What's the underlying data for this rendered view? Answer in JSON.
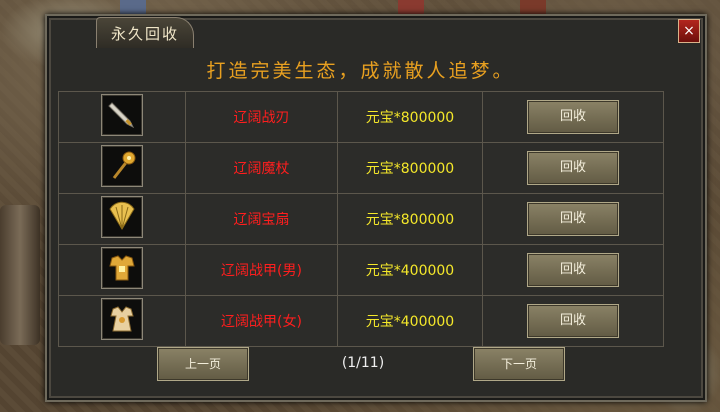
{
  "window": {
    "title": "永久回收",
    "close_label": "×"
  },
  "slogan": "打造完美生态，成就散人追梦。",
  "items": [
    {
      "icon": "blade-icon",
      "name": "辽阔战刃",
      "price": "元宝*800000",
      "action": "回收"
    },
    {
      "icon": "staff-icon",
      "name": "辽阔魔杖",
      "price": "元宝*800000",
      "action": "回收"
    },
    {
      "icon": "fan-icon",
      "name": "辽阔宝扇",
      "price": "元宝*800000",
      "action": "回收"
    },
    {
      "icon": "armor-male-icon",
      "name": "辽阔战甲(男)",
      "price": "元宝*400000",
      "action": "回收"
    },
    {
      "icon": "armor-female-icon",
      "name": "辽阔战甲(女)",
      "price": "元宝*400000",
      "action": "回收"
    }
  ],
  "pager": {
    "prev_label": "上一页",
    "page_indicator": "(1/11)",
    "next_label": "下一页"
  },
  "colors": {
    "item_name": "#ff1e1e",
    "price": "#f5e82a",
    "slogan": "#e8a020"
  }
}
